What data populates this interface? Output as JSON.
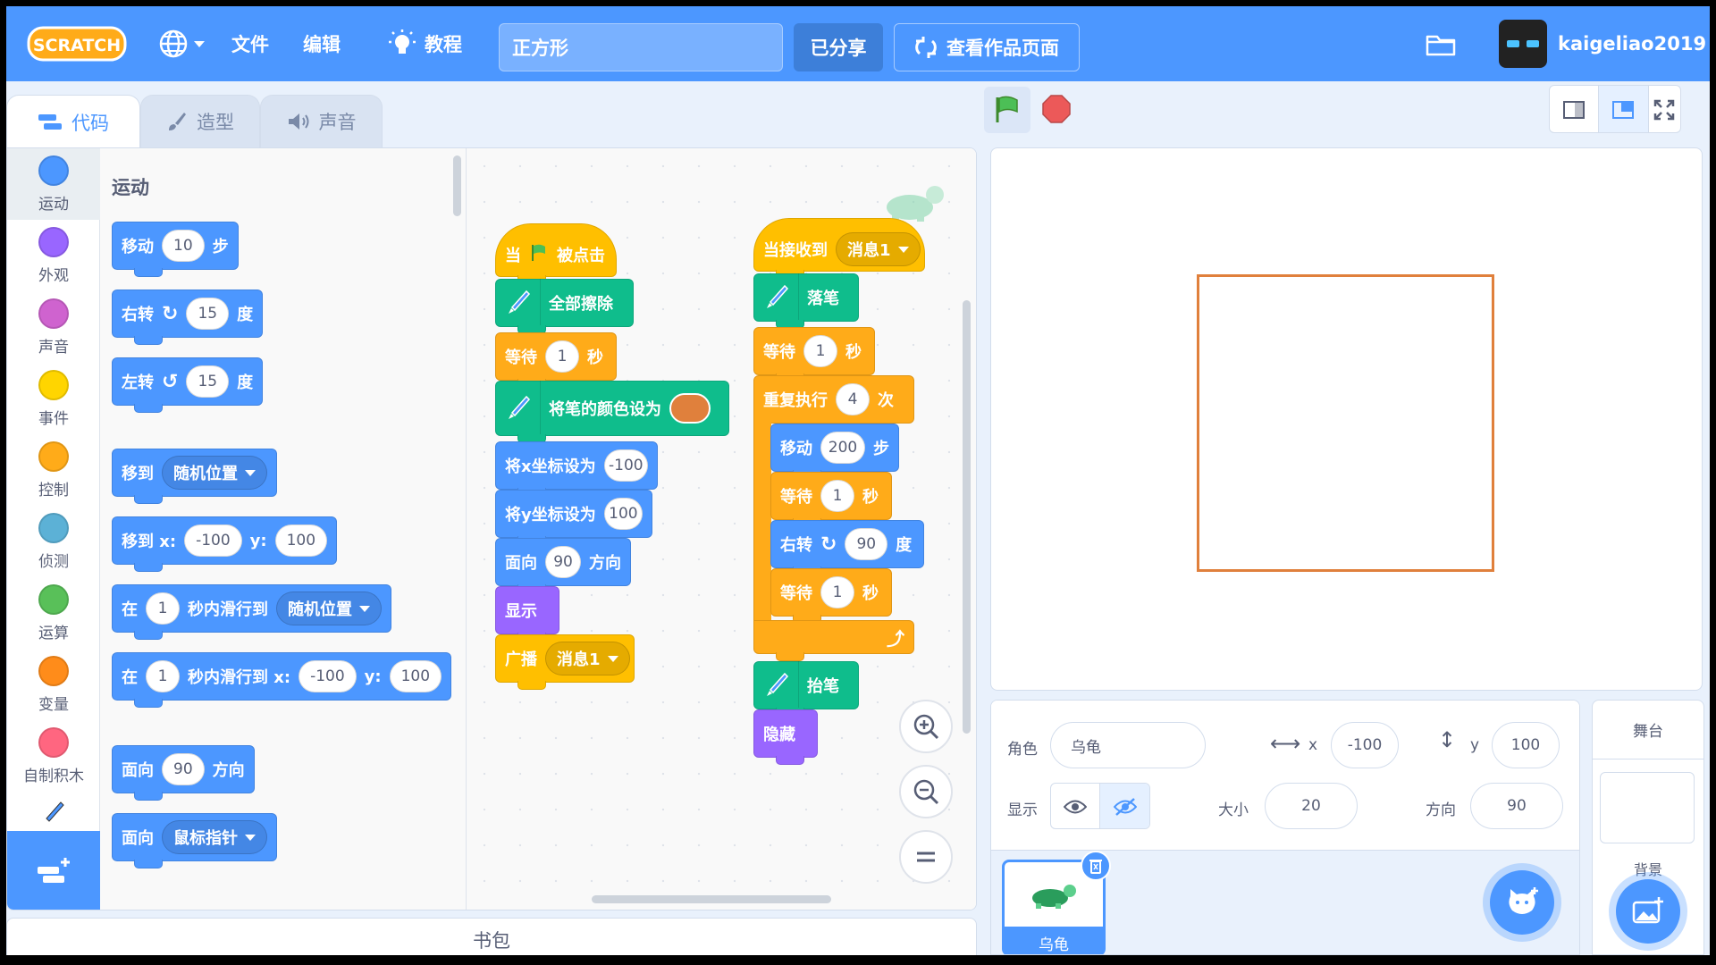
{
  "menubar": {
    "logo": "SCRATCH",
    "language_icon": "globe-icon",
    "file": "文件",
    "edit": "编辑",
    "tutorials": "教程",
    "project_title": "正方形",
    "share": "已分享",
    "see_project_page": "查看作品页面",
    "username": "kaigeliao2019"
  },
  "tabs": {
    "code": "代码",
    "costumes": "造型",
    "sounds": "声音"
  },
  "categories": [
    {
      "label": "运动",
      "color": "#4c97ff"
    },
    {
      "label": "外观",
      "color": "#9966ff"
    },
    {
      "label": "声音",
      "color": "#cf63cf"
    },
    {
      "label": "事件",
      "color": "#ffd500"
    },
    {
      "label": "控制",
      "color": "#ffab19"
    },
    {
      "label": "侦测",
      "color": "#5cb1d6"
    },
    {
      "label": "运算",
      "color": "#59c059"
    },
    {
      "label": "变量",
      "color": "#ff8c1a"
    },
    {
      "label": "自制积木",
      "color": "#ff6680"
    }
  ],
  "palette": {
    "title": "运动",
    "move": {
      "a": "移动",
      "v": "10",
      "b": "步"
    },
    "turn_right": {
      "a": "右转",
      "v": "15",
      "b": "度"
    },
    "turn_left": {
      "a": "左转",
      "v": "15",
      "b": "度"
    },
    "goto": {
      "a": "移到",
      "d": "随机位置"
    },
    "goto_xy": {
      "a": "移到 x:",
      "x": "-100",
      "y_label": "y:",
      "y": "100"
    },
    "glide": {
      "a": "在",
      "v": "1",
      "b": "秒内滑行到",
      "d": "随机位置"
    },
    "glide_xy": {
      "a": "在",
      "v": "1",
      "b": "秒内滑行到 x:",
      "x": "-100",
      "y_label": "y:",
      "y": "100"
    },
    "point_dir": {
      "a": "面向",
      "v": "90",
      "b": "方向"
    },
    "point_towards": {
      "a": "面向",
      "d": "鼠标指针"
    }
  },
  "script1": {
    "hat": {
      "a": "当",
      "b": "被点击"
    },
    "clear": "全部擦除",
    "wait": {
      "a": "等待",
      "v": "1",
      "b": "秒"
    },
    "set_color": "将笔的颜色设为",
    "pen_color": "#e0803c",
    "set_x": {
      "a": "将x坐标设为",
      "v": "-100"
    },
    "set_y": {
      "a": "将y坐标设为",
      "v": "100"
    },
    "point": {
      "a": "面向",
      "v": "90",
      "b": "方向"
    },
    "show": "显示",
    "broadcast": {
      "a": "广播",
      "d": "消息1"
    }
  },
  "script2": {
    "hat": {
      "a": "当接收到",
      "d": "消息1"
    },
    "pen_down": "落笔",
    "wait1": {
      "a": "等待",
      "v": "1",
      "b": "秒"
    },
    "repeat": {
      "a": "重复执行",
      "v": "4",
      "b": "次"
    },
    "move": {
      "a": "移动",
      "v": "200",
      "b": "步"
    },
    "wait2": {
      "a": "等待",
      "v": "1",
      "b": "秒"
    },
    "turn": {
      "a": "右转",
      "v": "90",
      "b": "度"
    },
    "wait3": {
      "a": "等待",
      "v": "1",
      "b": "秒"
    },
    "pen_up": "抬笔",
    "hide": "隐藏"
  },
  "sprite_info": {
    "sprite_label": "角色",
    "sprite_name": "乌龟",
    "x_label": "x",
    "x": "-100",
    "y_label": "y",
    "y": "100",
    "show_label": "显示",
    "size_label": "大小",
    "size": "20",
    "direction_label": "方向",
    "direction": "90"
  },
  "sprites": [
    {
      "name": "乌龟"
    }
  ],
  "stage_panel": {
    "title": "舞台",
    "backdrops": "背景"
  },
  "backpack": "书包",
  "colors": {
    "accent": "#4c97ff",
    "pen_line": "#e0803c"
  }
}
